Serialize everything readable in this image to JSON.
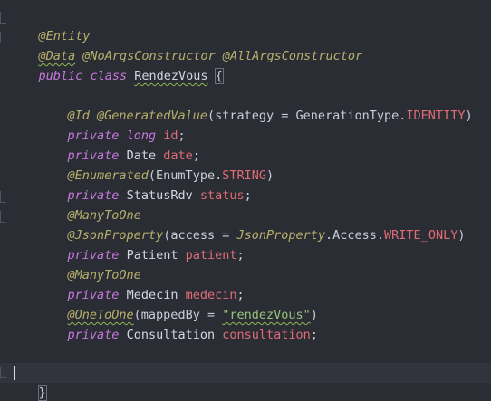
{
  "code": {
    "entity": "@Entity",
    "data_ann": "@Data",
    "noargs_ann": "@NoArgsConstructor",
    "allargs_ann": "@AllArgsConstructor",
    "public_kw": "public",
    "class_kw": "class",
    "class_name": "RendezVous",
    "open_brace": "{",
    "id_ann": "@Id",
    "gen_ann": "@GeneratedValue",
    "gen_args_open": "(strategy = GenerationType.",
    "gen_const": "IDENTITY",
    "gen_args_close": ")",
    "private_kw": "private",
    "long_kw": "long",
    "id_field": "id",
    "semi": ";",
    "date_type": "Date",
    "date_field": "date",
    "enum_ann": "@Enumerated",
    "enum_args_open": "(EnumType.",
    "enum_const": "STRING",
    "enum_args_close": ")",
    "status_type": "StatusRdv",
    "status_field": "status",
    "many_to_one": "@ManyToOne",
    "json_ann": "@JsonProperty",
    "json_args_open": "(access = ",
    "json_ref": "JsonProperty",
    "json_args_mid": ".Access.",
    "json_const": "WRITE_ONLY",
    "json_args_close": ")",
    "patient_type": "Patient",
    "patient_field": "patient",
    "medecin_type": "Medecin",
    "medecin_field": "medecin",
    "one_to_one": "@OneToOne",
    "mapped_open": "(mappedBy = ",
    "mapped_str": "\"rendezVous\"",
    "mapped_close": ")",
    "consultation_type": "Consultation",
    "consultation_field": "consultation",
    "close_brace": "}"
  },
  "colors": {
    "background": "#2b2d35",
    "annotation": "#b7b06b",
    "keyword": "#c678dd",
    "field": "#e06c75",
    "string": "#98c379"
  }
}
